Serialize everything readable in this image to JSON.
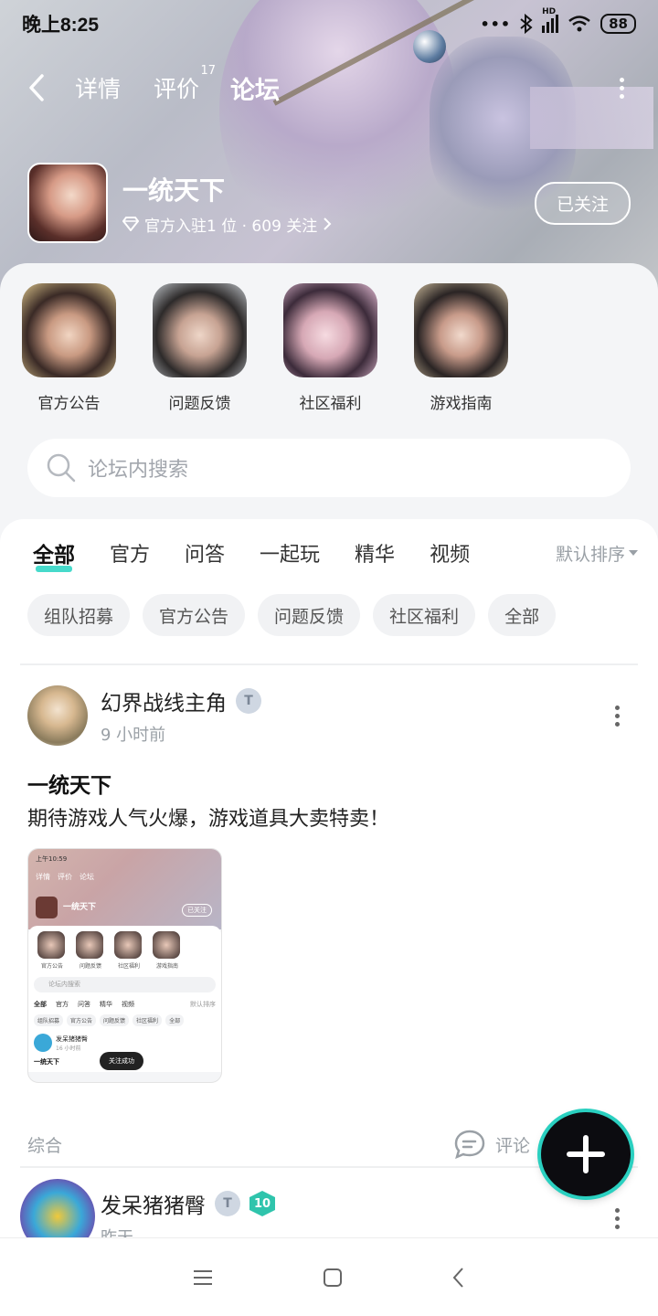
{
  "status_bar": {
    "time": "晚上8:25",
    "signal_label": "HD",
    "battery": "88"
  },
  "nav": {
    "tabs": [
      {
        "label": "详情",
        "badge": ""
      },
      {
        "label": "评价",
        "badge": "17"
      },
      {
        "label": "论坛",
        "badge": ""
      }
    ],
    "active_tab": "论坛"
  },
  "game": {
    "name": "一统天下",
    "meta": "官方入驻1 位 · 609 关注",
    "follow_label": "已关注"
  },
  "categories": [
    {
      "label": "官方公告"
    },
    {
      "label": "问题反馈"
    },
    {
      "label": "社区福利"
    },
    {
      "label": "游戏指南"
    }
  ],
  "search": {
    "placeholder": "论坛内搜索"
  },
  "feed_tabs": [
    "全部",
    "官方",
    "问答",
    "一起玩",
    "精华",
    "视频"
  ],
  "feed_active": "全部",
  "sort_label": "默认排序",
  "chips": [
    "组队招募",
    "官方公告",
    "问题反馈",
    "社区福利",
    "全部"
  ],
  "posts": [
    {
      "user": "幻界战线主角",
      "time": "9 小时前",
      "title": "一统天下",
      "body": "期待游戏人气火爆，游戏道具大卖特卖！",
      "tag": "综合",
      "comment_label": "评论",
      "screenshot": {
        "time": "上午10:59",
        "tabs": [
          "详情",
          "评价",
          "论坛"
        ],
        "game_name": "一统天下",
        "follow": "已关注",
        "cats": [
          "官方公告",
          "问题反馈",
          "社区福利",
          "游戏指南"
        ],
        "search": "论坛内搜索",
        "ftabs": [
          "全部",
          "官方",
          "问答",
          "精华",
          "视频"
        ],
        "sort": "默认排序",
        "chips": [
          "组队招募",
          "官方公告",
          "问题反馈",
          "社区福利",
          "全部"
        ],
        "user": "发呆猪猪臀",
        "user_time": "16 小时前",
        "title": "一统天下",
        "toast": "关注成功"
      }
    },
    {
      "user": "发呆猪猪臀",
      "time": "昨天",
      "level": "10"
    }
  ],
  "colors": {
    "accent": "#27d4c2"
  }
}
